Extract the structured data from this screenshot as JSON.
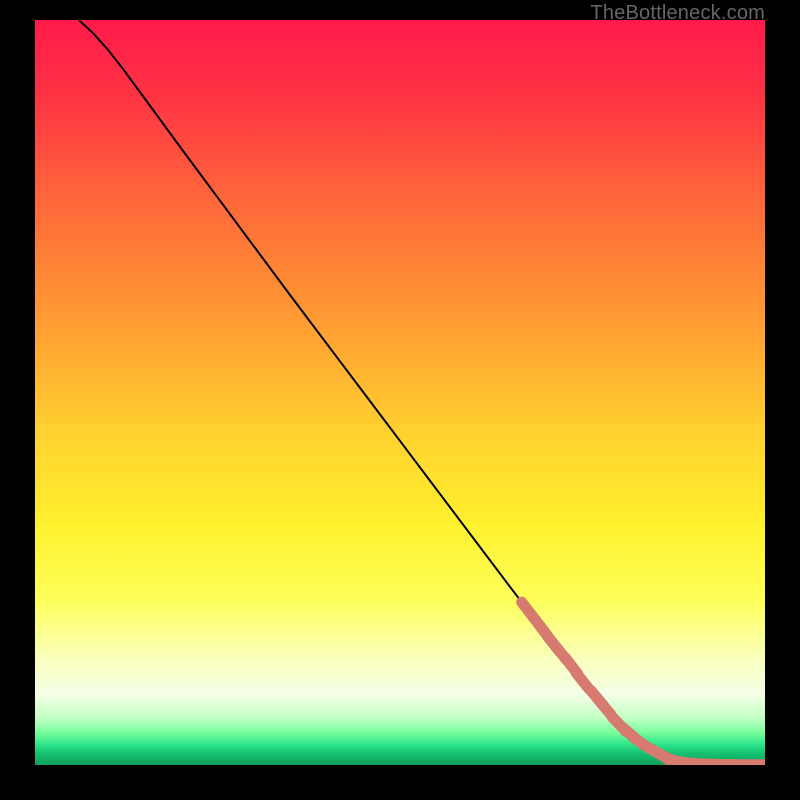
{
  "watermark": "TheBottleneck.com",
  "colors": {
    "background": "#000000",
    "gradient_stops": [
      {
        "offset": 0.0,
        "color": "#ff1a4b"
      },
      {
        "offset": 0.1,
        "color": "#ff3344"
      },
      {
        "offset": 0.25,
        "color": "#ff6a3a"
      },
      {
        "offset": 0.4,
        "color": "#ff9a33"
      },
      {
        "offset": 0.55,
        "color": "#ffd02f"
      },
      {
        "offset": 0.68,
        "color": "#fff22e"
      },
      {
        "offset": 0.78,
        "color": "#fdff5a"
      },
      {
        "offset": 0.86,
        "color": "#faffc0"
      },
      {
        "offset": 0.905,
        "color": "#f4ffe6"
      },
      {
        "offset": 0.935,
        "color": "#c7ffc7"
      },
      {
        "offset": 0.955,
        "color": "#7eff9e"
      },
      {
        "offset": 0.972,
        "color": "#2fe68c"
      },
      {
        "offset": 0.985,
        "color": "#15c06f"
      },
      {
        "offset": 1.0,
        "color": "#0e9e5a"
      }
    ],
    "curve": "#000000",
    "marker_fill": "#d77a6f",
    "marker_stroke": "#d77a6f"
  },
  "chart_data": {
    "type": "line",
    "title": "",
    "xlabel": "",
    "ylabel": "",
    "xlim": [
      0,
      100
    ],
    "ylim": [
      0,
      100
    ],
    "series": [
      {
        "name": "curve",
        "x": [
          6,
          8,
          10,
          12,
          15,
          20,
          25,
          30,
          35,
          40,
          45,
          50,
          55,
          60,
          65,
          70,
          75,
          80,
          82,
          84,
          86,
          88,
          90,
          92,
          94,
          96,
          98,
          100
        ],
        "y": [
          100,
          98.2,
          96.0,
          93.5,
          89.5,
          82.8,
          76.2,
          69.6,
          63.0,
          56.5,
          50.0,
          43.5,
          37.0,
          30.5,
          24.0,
          17.6,
          11.3,
          5.5,
          3.8,
          2.4,
          1.3,
          0.6,
          0.25,
          0.12,
          0.06,
          0.04,
          0.03,
          0.03
        ]
      }
    ],
    "markers": {
      "name": "highlighted-points",
      "x": [
        67.5,
        69.0,
        70.0,
        71.0,
        72.0,
        73.5,
        75.0,
        77.0,
        78.0,
        80.0,
        81.5,
        83.0,
        85.0,
        87.0,
        88.0,
        90.0,
        93.0,
        96.0,
        99.0
      ],
      "y": [
        20.8,
        18.9,
        17.6,
        16.3,
        15.1,
        13.3,
        11.3,
        9.0,
        7.8,
        5.5,
        4.2,
        3.0,
        1.8,
        0.8,
        0.5,
        0.25,
        0.1,
        0.05,
        0.03
      ]
    }
  }
}
